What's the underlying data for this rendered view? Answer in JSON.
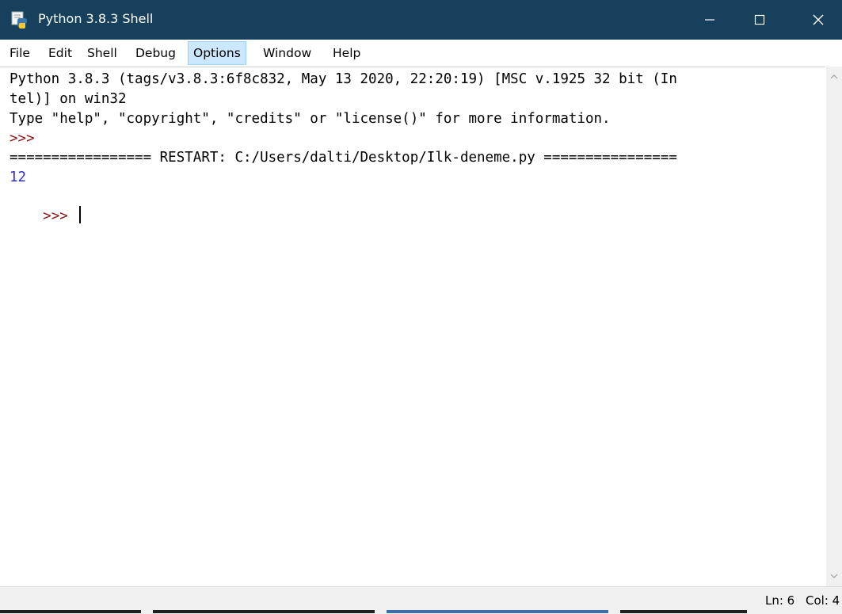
{
  "window": {
    "title": "Python 3.8.3 Shell",
    "titlebar_color": "#16405c",
    "icon": "python-idle-icon"
  },
  "controls": {
    "minimize_icon": "minimize-icon",
    "maximize_icon": "maximize-icon",
    "close_icon": "close-icon"
  },
  "menu": {
    "items": [
      "File",
      "Edit",
      "Shell",
      "Debug",
      "Options",
      "Window",
      "Help"
    ],
    "highlighted": "Options"
  },
  "shell": {
    "lines": [
      {
        "text": "Python 3.8.3 (tags/v3.8.3:6f8c832, May 13 2020, 22:20:19) [MSC v.1925 32 bit (In",
        "style": "stdout"
      },
      {
        "text": "tel)] on win32",
        "style": "stdout"
      },
      {
        "text": "Type \"help\", \"copyright\", \"credits\" or \"license()\" for more information.",
        "style": "stdout"
      },
      {
        "text": ">>>",
        "style": "prompt"
      },
      {
        "text": "================= RESTART: C:/Users/dalti/Desktop/Ilk-deneme.py ================",
        "style": "stdout"
      },
      {
        "text": "12",
        "style": "output"
      },
      {
        "text": ">>> ",
        "style": "prompt"
      }
    ],
    "colors": {
      "prompt": "#8b1a1a",
      "output": "#2f2fd0",
      "stdout": "#000000"
    }
  },
  "status": {
    "line": "Ln: 6",
    "col": "Col: 4"
  }
}
